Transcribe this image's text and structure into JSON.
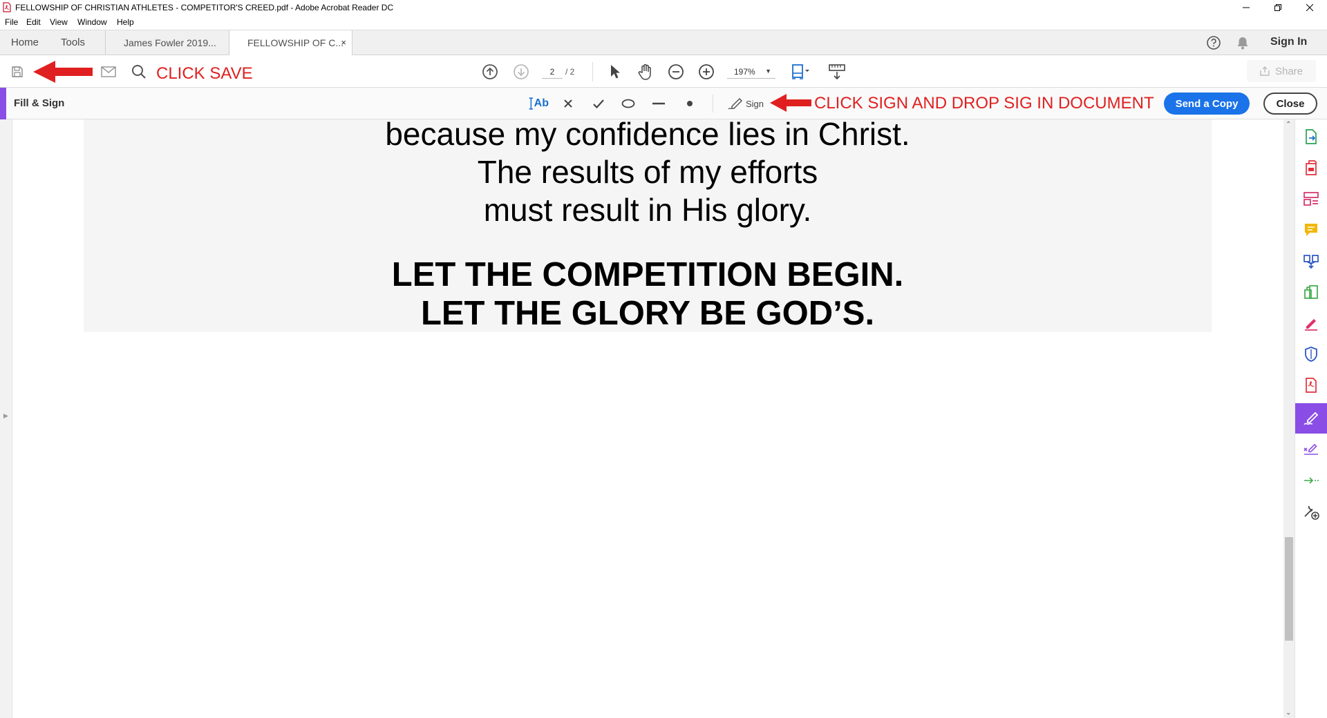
{
  "window": {
    "title": "FELLOWSHIP OF CHRISTIAN ATHLETES - COMPETITOR'S CREED.pdf - Adobe Acrobat Reader DC"
  },
  "menu": [
    "File",
    "Edit",
    "View",
    "Window",
    "Help"
  ],
  "nav": {
    "home": "Home",
    "tools": "Tools",
    "sign_in": "Sign In"
  },
  "tabs": [
    {
      "label": "James Fowler 2019..."
    },
    {
      "label": "FELLOWSHIP OF C...",
      "close": "×"
    }
  ],
  "toolbar": {
    "page_current": "2",
    "page_total": "/ 2",
    "zoom": "197%",
    "share_label": "Share"
  },
  "annotations": {
    "save": "CLICK SAVE",
    "sign": "CLICK SIGN AND DROP SIG IN DOCUMENT",
    "color": "#e02020"
  },
  "fill_sign": {
    "title": "Fill & Sign",
    "text_tool": "Ab",
    "sign_label": "Sign",
    "send_copy": "Send a Copy",
    "close": "Close",
    "accent": "#8a4ee6",
    "primary": "#1a73e8"
  },
  "document": {
    "lines": [
      "because my confidence lies in Christ.",
      "The results of my efforts",
      "must result in His glory."
    ],
    "closing": [
      "LET THE COMPETITION BEGIN.",
      "LET THE GLORY BE GOD’S."
    ]
  },
  "rail_icons": [
    "create-pdf-icon",
    "export-pdf-icon",
    "organize-pages-icon",
    "comment-icon",
    "combine-files-icon",
    "compress-pdf-icon",
    "edit-pdf-icon",
    "protect-icon",
    "pdf-convert-icon",
    "fill-sign-icon",
    "request-signature-icon",
    "send-track-icon",
    "more-tools-icon"
  ]
}
